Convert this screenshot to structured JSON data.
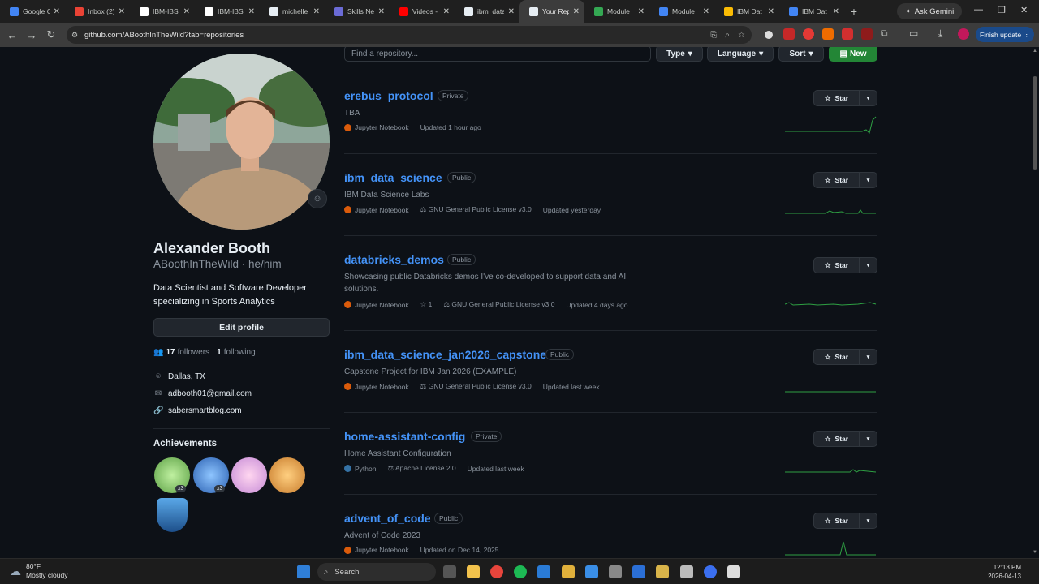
{
  "browser": {
    "tabs": [
      {
        "label": "Google C",
        "color": "#4285f4"
      },
      {
        "label": "Inbox (2)",
        "color": "#ea4335"
      },
      {
        "label": "IBM-IBS",
        "color": "#ffffff"
      },
      {
        "label": "IBM-IBS",
        "color": "#ffffff"
      },
      {
        "label": "michelle",
        "color": "#e6edf3"
      },
      {
        "label": "Skills Ne",
        "color": "#6b6bd6"
      },
      {
        "label": "Videos -",
        "color": "#ff0000"
      },
      {
        "label": "ibm_data",
        "color": "#e6edf3"
      },
      {
        "label": "Your Rep",
        "color": "#e6edf3",
        "active": true
      },
      {
        "label": "Module ",
        "color": "#34a853"
      },
      {
        "label": "Module",
        "color": "#4285f4"
      },
      {
        "label": "IBM Dat",
        "color": "#fbbc04"
      },
      {
        "label": "IBM Dat",
        "color": "#4285f4"
      }
    ],
    "ask_gemini": "Ask Gemini",
    "url": "github.com/ABoothInTheWild?tab=repositories",
    "finish_update": "Finish update"
  },
  "profile": {
    "full_name": "Alexander Booth",
    "handle": "ABoothInTheWild · he/him",
    "bio": "Data Scientist and Software Developer specializing in Sports Analytics",
    "edit_label": "Edit profile",
    "followers_count": "17",
    "followers_label": "followers ·",
    "following_count": "1",
    "following_label": "following",
    "location": "Dallas, TX",
    "email": "adbooth01@gmail.com",
    "website": "sabersmartblog.com",
    "achievements_title": "Achievements",
    "achievement_counts": [
      "x3",
      "x3"
    ]
  },
  "filters": {
    "search_placeholder": "Find a repository...",
    "type_label": "Type",
    "language_label": "Language",
    "sort_label": "Sort",
    "new_label": "New"
  },
  "star_label": "Star",
  "repos": [
    {
      "name": "erebus_protocol",
      "visibility": "Private",
      "description": "TBA",
      "language": "Jupyter Notebook",
      "lang_color": "#da5b0b",
      "stars": "",
      "license": "",
      "updated": "Updated 1 hour ago"
    },
    {
      "name": "ibm_data_science",
      "visibility": "Public",
      "description": "IBM Data Science Labs",
      "language": "Jupyter Notebook",
      "lang_color": "#da5b0b",
      "stars": "",
      "license": "GNU General Public License v3.0",
      "updated": "Updated yesterday"
    },
    {
      "name": "databricks_demos",
      "visibility": "Public",
      "description": "Showcasing public Databricks demos I've co-developed to support data and AI solutions.",
      "language": "Jupyter Notebook",
      "lang_color": "#da5b0b",
      "stars": "1",
      "license": "GNU General Public License v3.0",
      "updated": "Updated 4 days ago"
    },
    {
      "name": "ibm_data_science_jan2026_capstone",
      "visibility": "Public",
      "description": "Capstone Project for IBM Jan 2026 (EXAMPLE)",
      "language": "Jupyter Notebook",
      "lang_color": "#da5b0b",
      "stars": "",
      "license": "GNU General Public License v3.0",
      "updated": "Updated last week"
    },
    {
      "name": "home-assistant-config",
      "visibility": "Private",
      "description": "Home Assistant Configuration",
      "language": "Python",
      "lang_color": "#3572a5",
      "stars": "",
      "license": "Apache License 2.0",
      "updated": "Updated last week"
    },
    {
      "name": "advent_of_code",
      "visibility": "Public",
      "description": "Advent of Code 2023",
      "language": "Jupyter Notebook",
      "lang_color": "#da5b0b",
      "stars": "",
      "license": "",
      "updated": "Updated on Dec 14, 2025"
    }
  ],
  "taskbar": {
    "temp": "80°F",
    "weather": "Mostly cloudy",
    "search_label": "Search",
    "time": "12:13 PM",
    "date": "2026-04-13"
  }
}
